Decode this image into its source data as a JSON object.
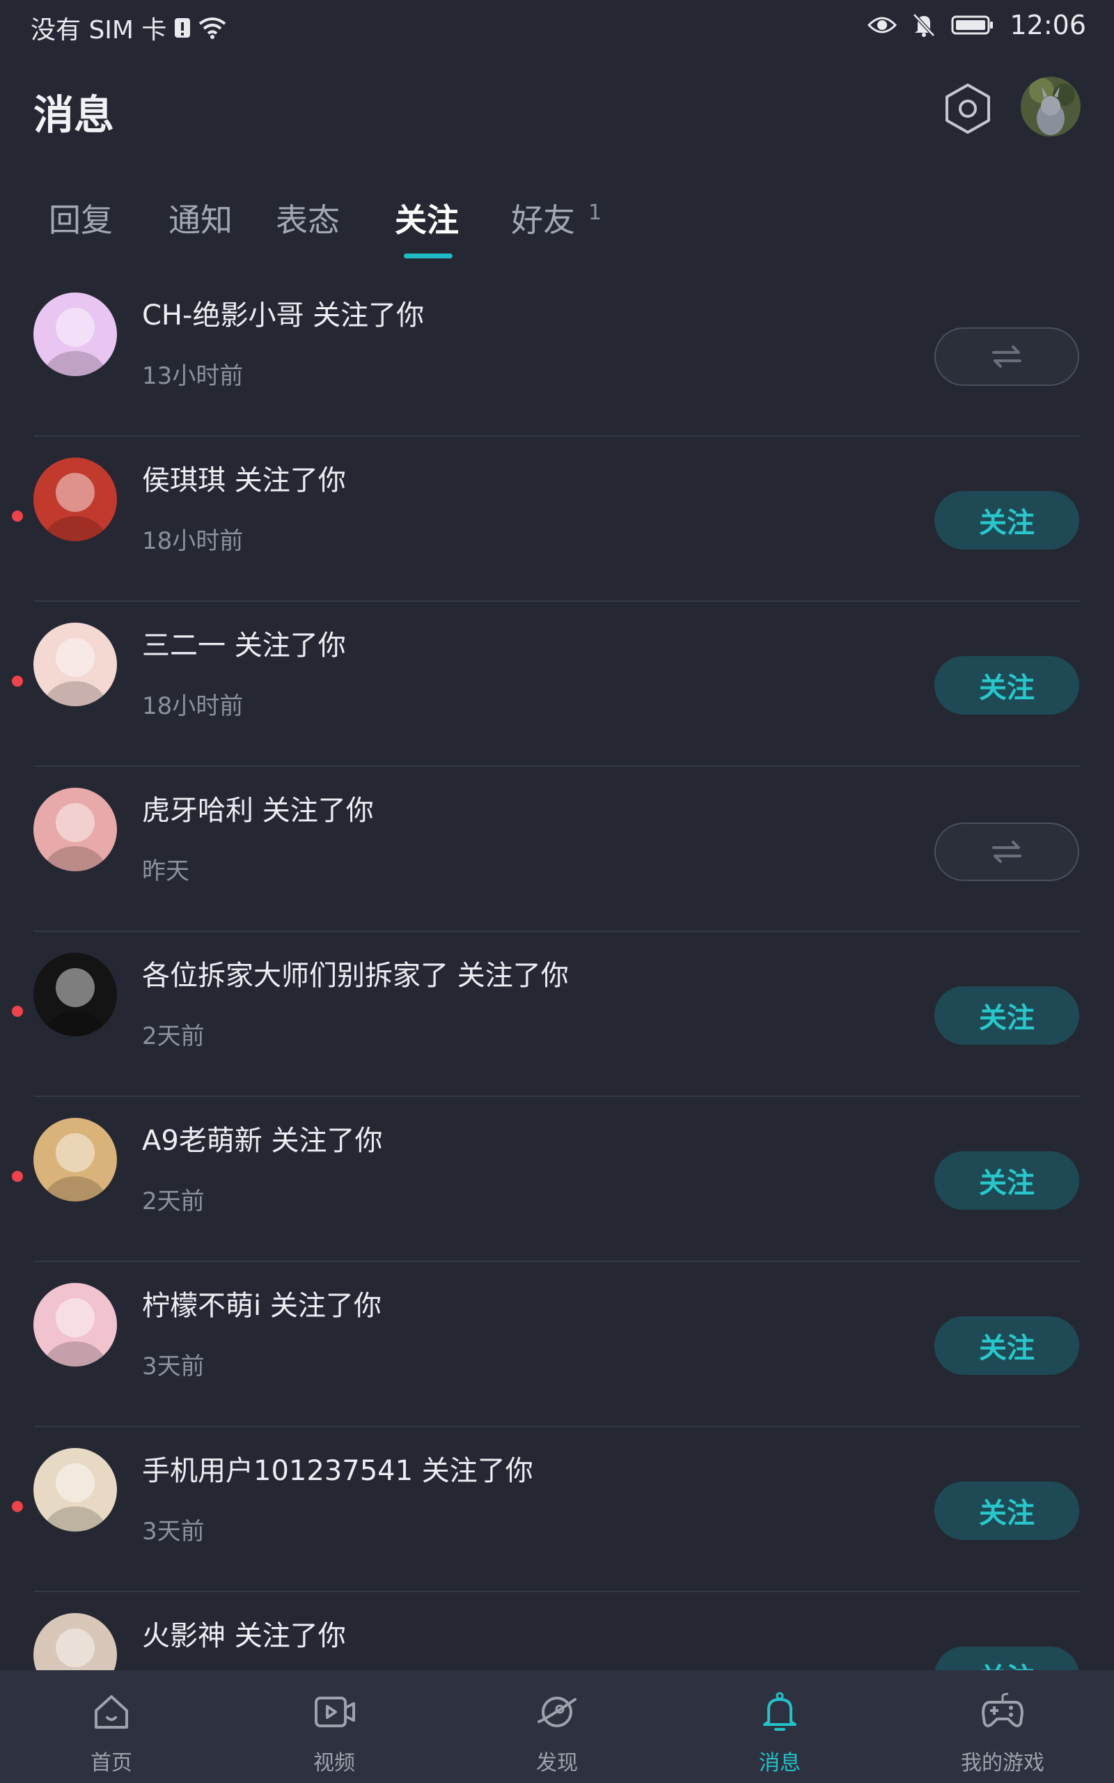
{
  "status_bar": {
    "carrier": "没有 SIM 卡",
    "time": "12:06",
    "icons": [
      "sim-alert-icon",
      "wifi-icon",
      "eye-icon",
      "bell-off-icon",
      "battery-icon"
    ]
  },
  "header": {
    "title": "消息",
    "settings_icon": "settings-icon"
  },
  "tabs": {
    "items": [
      {
        "label": "回复"
      },
      {
        "label": "通知"
      },
      {
        "label": "表态"
      },
      {
        "label": "关注",
        "active": true
      },
      {
        "label": "好友",
        "badge": "1"
      }
    ]
  },
  "list": {
    "items": [
      {
        "name": "CH-绝影小哥 关注了你",
        "time": "13小时前",
        "unread": false,
        "button": "mutual",
        "avatar_color": "#e9c6f2"
      },
      {
        "name": "侯琪琪 关注了你",
        "time": "18小时前",
        "unread": true,
        "button": "follow",
        "avatar_color": "#c23a2e"
      },
      {
        "name": "三二一 关注了你",
        "time": "18小时前",
        "unread": true,
        "button": "follow",
        "avatar_color": "#f4d8d2"
      },
      {
        "name": "虎牙哈利 关注了你",
        "time": "昨天",
        "unread": false,
        "button": "mutual",
        "avatar_color": "#e7a9a9"
      },
      {
        "name": "各位拆家大师们别拆家了 关注了你",
        "time": "2天前",
        "unread": true,
        "button": "follow",
        "avatar_color": "#141414"
      },
      {
        "name": "A9老萌新 关注了你",
        "time": "2天前",
        "unread": true,
        "button": "follow",
        "avatar_color": "#d9b37a"
      },
      {
        "name": "柠檬不萌i 关注了你",
        "time": "3天前",
        "unread": false,
        "button": "follow",
        "avatar_color": "#f1c3cf"
      },
      {
        "name": "手机用户101237541 关注了你",
        "time": "3天前",
        "unread": true,
        "button": "follow",
        "avatar_color": "#e8d9c4"
      },
      {
        "name": "火影神 关注了你",
        "time": "",
        "unread": false,
        "button": "follow",
        "avatar_color": "#d8c6b8"
      }
    ],
    "follow_label": "关注"
  },
  "bottom_nav": {
    "items": [
      {
        "label": "首页",
        "icon": "home-icon"
      },
      {
        "label": "视频",
        "icon": "video-icon"
      },
      {
        "label": "发现",
        "icon": "planet-icon"
      },
      {
        "label": "消息",
        "icon": "bell-icon",
        "active": true
      },
      {
        "label": "我的游戏",
        "icon": "gamepad-icon"
      }
    ]
  },
  "colors": {
    "background": "#252833",
    "accent": "#22c2c8",
    "unread": "#f0424a",
    "follow_button_bg": "#1f4a55"
  }
}
